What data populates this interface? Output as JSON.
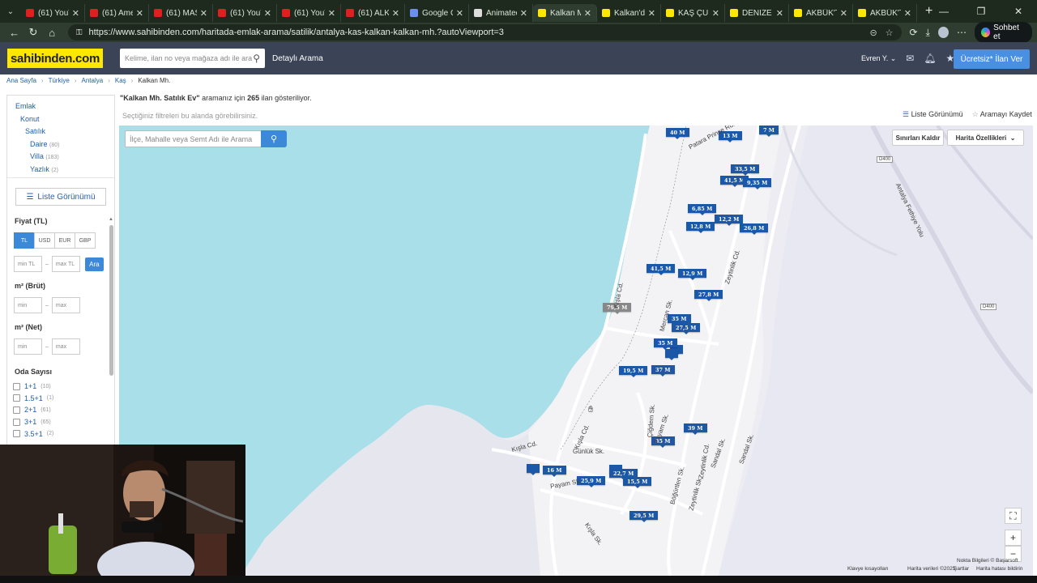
{
  "browser": {
    "tabs": [
      {
        "title": "(61) YouTube",
        "favicon_color": "#e02020"
      },
      {
        "title": "(61) Amerika",
        "favicon_color": "#e02020"
      },
      {
        "title": "(61) MASTER",
        "favicon_color": "#e02020"
      },
      {
        "title": "(61) YouTube",
        "favicon_color": "#e02020"
      },
      {
        "title": "(61) YouTube",
        "favicon_color": "#e02020"
      },
      {
        "title": "(61) ALKOL",
        "favicon_color": "#e02020"
      },
      {
        "title": "Google Gemini",
        "favicon_color": "#6b8ef0"
      },
      {
        "title": "Animated G",
        "favicon_color": "#dddddd"
      },
      {
        "title": "Kalkan Mh.",
        "favicon_color": "#ffe800",
        "active": true
      },
      {
        "title": "Kalkan'da d",
        "favicon_color": "#ffe800"
      },
      {
        "title": "KAŞ ÇUKUR",
        "favicon_color": "#ffe800"
      },
      {
        "title": "DENİZE 100",
        "favicon_color": "#ffe800"
      },
      {
        "title": "AKBÜK'TE D",
        "favicon_color": "#ffe800"
      },
      {
        "title": "AKBÜK'TE D",
        "favicon_color": "#ffe800"
      }
    ],
    "url": "https://www.sahibinden.com/haritada-emlak-arama/satilik/antalya-kas-kalkan-kalkan-mh.?autoViewport=3",
    "copilot_label": "Sohbet et"
  },
  "site": {
    "logo": "sahibinden.com",
    "search_placeholder": "Kelime, ilan no veya mağaza adı ile ara",
    "detailed_search": "Detaylı Arama",
    "username": "Evren Y.",
    "post_button": "Ücretsiz* İlan Ver"
  },
  "breadcrumb": [
    "Ana Sayfa",
    "Türkiye",
    "Antalya",
    "Kaş",
    "Kalkan Mh."
  ],
  "sidebar": {
    "categories": [
      {
        "label": "Emlak",
        "indent": 0,
        "count": ""
      },
      {
        "label": "Konut",
        "indent": 1,
        "count": ""
      },
      {
        "label": "Satılık",
        "indent": 2,
        "count": ""
      },
      {
        "label": "Daire",
        "indent": 3,
        "count": "(80)"
      },
      {
        "label": "Villa",
        "indent": 3,
        "count": "(183)"
      },
      {
        "label": "Yazlık",
        "indent": 3,
        "count": "(2)"
      }
    ],
    "list_view_button": "Liste Görünümü",
    "price_label": "Fiyat (TL)",
    "currencies": [
      "TL",
      "USD",
      "EUR",
      "GBP"
    ],
    "selected_currency": "TL",
    "price_min_placeholder": "min TL",
    "price_max_placeholder": "max TL",
    "search_button": "Ara",
    "gross_label": "m² (Brüt)",
    "net_label": "m² (Net)",
    "min_placeholder": "min",
    "max_placeholder": "max",
    "rooms_label": "Oda Sayısı",
    "rooms": [
      {
        "label": "1+1",
        "count": "(10)"
      },
      {
        "label": "1.5+1",
        "count": "(1)"
      },
      {
        "label": "2+1",
        "count": "(61)"
      },
      {
        "label": "3+1",
        "count": "(65)"
      },
      {
        "label": "3.5+1",
        "count": "(2)"
      }
    ]
  },
  "results": {
    "query": "\"Kalkan Mh. Satılık Ev\"",
    "text_a": " aramanız için ",
    "count": "265",
    "text_b": " ilan gösteriliyor.",
    "hint": "Seçtiğiniz filtreleri bu alanda görebilirsiniz.",
    "list_view": "Liste Görünümü",
    "save_search": "Aramayı Kaydet"
  },
  "map": {
    "search_placeholder": "İlçe, Mahalle veya Semt  Adı ile Arama",
    "remove_bounds": "Sınırları Kaldır",
    "map_features": "Harita Özellikleri",
    "price_pins": [
      "40 M",
      "13 M",
      "7 M",
      "33,5 M",
      "41,5 M",
      "9,35 M",
      "6,85 M",
      "12,2 M",
      "12,8 M",
      "26,8 M",
      "41,5 M",
      "12,9 M",
      "27,8 M",
      "79,5 M",
      "35 M",
      "27,5 M",
      "35 M",
      "37 M",
      "19,5 M",
      "39 M",
      "35 M",
      "16 M",
      "22,7 M",
      "25,9 M",
      "15,5 M",
      "29,5 M"
    ],
    "streets": [
      "Patara Prince Rd.",
      "Zeytinlik Cd.",
      "Antalya Fethiye Yolu",
      "D400",
      "D400",
      "Kışla Cd.",
      "Mercan Sk.",
      "Sandal Sk.",
      "Çiğdem Sk.",
      "Payam Sk.",
      "Günlük Sk.",
      "Kışla Cd.",
      "Payam Sk.",
      "Böğürtlen Sk.",
      "Zeytinlik Sk.",
      "Kışla Sk.",
      "Kışla Cd.",
      "Sandal Sk.",
      "Zeytinlik Cd."
    ],
    "attribution": {
      "keyboard": "Klavye kısayolları",
      "data": "Harita verileri ©2025",
      "terms": "Şartlar",
      "report": "Harita hatası bildirin",
      "points": "Nokta Bilgileri © Başarsoft"
    }
  },
  "colors": {
    "sea": "#a8dfe9",
    "land": "#ececf2",
    "pin": "#1b58a8",
    "brand_yellow": "#ffe800",
    "header": "#3b4356"
  }
}
